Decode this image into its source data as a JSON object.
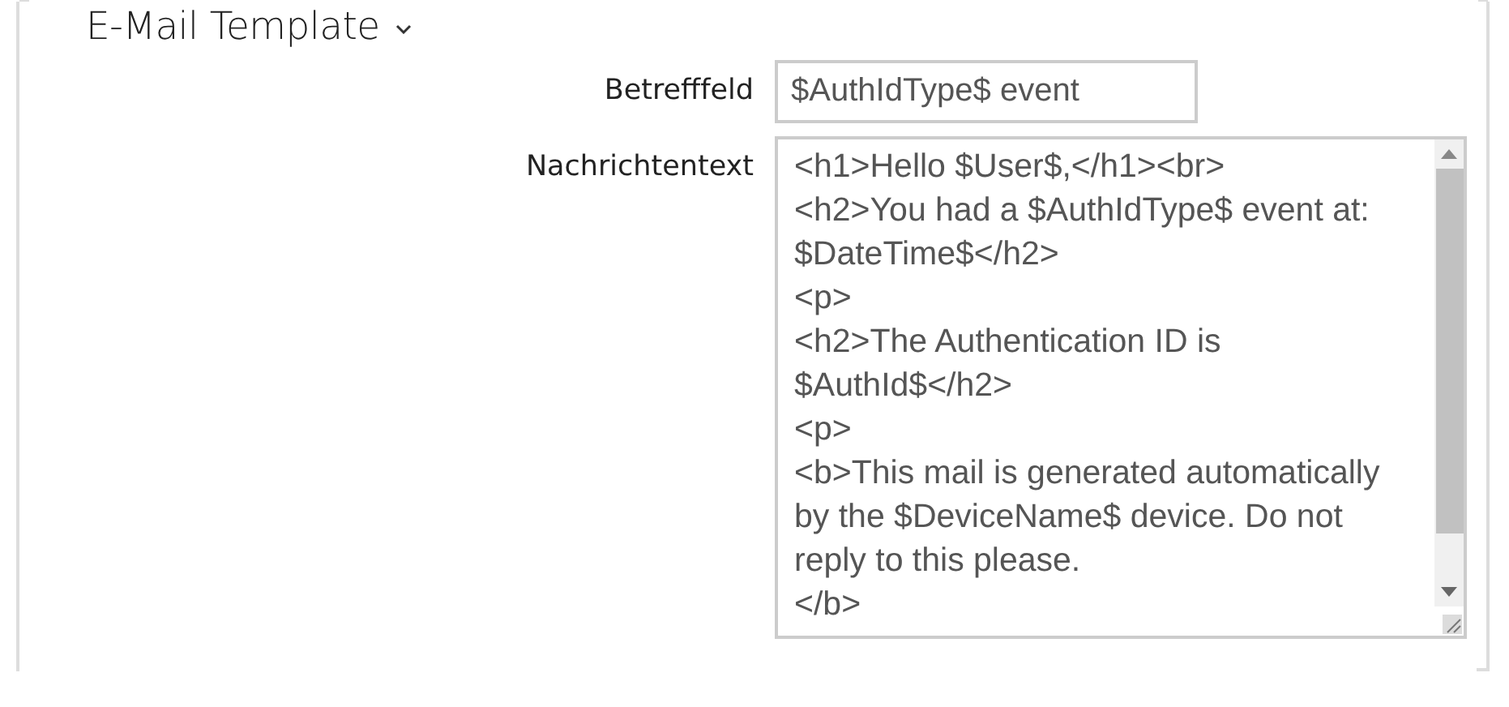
{
  "section": {
    "title": "E-Mail Template",
    "expanded": true
  },
  "fields": [
    {
      "kind": "input",
      "label": "Betrefffeld",
      "value": "$AuthIdType$ event"
    },
    {
      "kind": "textarea",
      "label": "Nachrichtentext",
      "value": "<h1>Hello $User$,</h1><br>\n<h2>You had a $AuthIdType$ event at: $DateTime$</h2>\n<p>\n<h2>The Authentication ID is $AuthId$</h2>\n<p>\n<b>This mail is generated automatically by the $DeviceName$ device. Do not reply to this please.\n</b>"
    }
  ]
}
